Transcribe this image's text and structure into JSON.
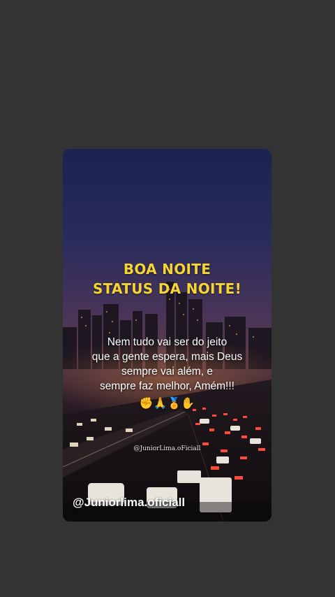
{
  "post": {
    "title_line1": "BOA NOITE",
    "title_line2": "STATUS DA NOITE!",
    "message_lines": [
      "Nem tudo vai ser do jeito",
      "que a gente espera, mais Deus",
      "sempre vai além, e",
      "sempre faz melhor, Amém!!!"
    ],
    "emojis": "✊🙏🏅✋",
    "watermark": "@JuniorLima.oFiciall",
    "handle": "@Juniorlima.oficiall"
  },
  "colors": {
    "page_background": "#333333",
    "title": "#f5d433",
    "text": "#ffffff"
  }
}
